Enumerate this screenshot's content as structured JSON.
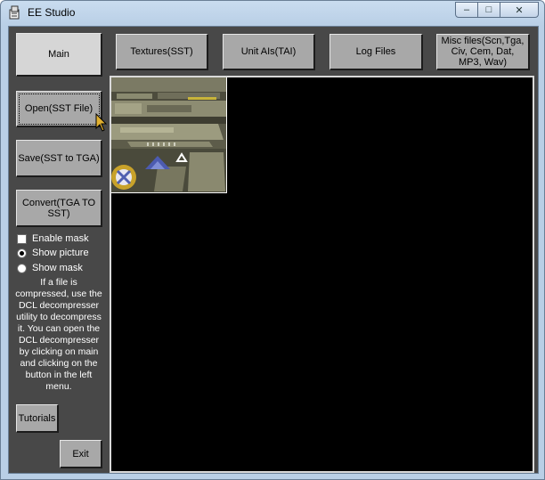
{
  "window": {
    "title": "EE Studio"
  },
  "caption": {
    "minimize": "–",
    "maximize": "□",
    "close": "✕"
  },
  "tabs": {
    "main": "Main",
    "textures": "Textures(SST)",
    "unit_ais": "Unit AIs(TAI)",
    "log_files": "Log Files",
    "misc": "Misc files(Scn,Tga, Civ, Cem, Dat, MP3, Wav)"
  },
  "actions": {
    "open": "Open(SST File)",
    "save": "Save(SST to TGA)",
    "convert": "Convert(TGA TO SST)"
  },
  "options": {
    "enable_mask": {
      "label": "Enable mask",
      "checked": false
    },
    "show_picture": {
      "label": "Show picture",
      "selected": true
    },
    "show_mask": {
      "label": "Show mask",
      "selected": false
    }
  },
  "help_text": "If a file is compressed, use the DCL decompresser utility to decompress it. You can open the DCL decompresser by clicking on main and clicking on the button in the left menu.",
  "tutorials": "Tutorials",
  "exit": "Exit",
  "colors": {
    "panel": "#484848",
    "button": "#a8a8a8",
    "canvas": "#000000",
    "title_bar": "#c9dcef"
  }
}
